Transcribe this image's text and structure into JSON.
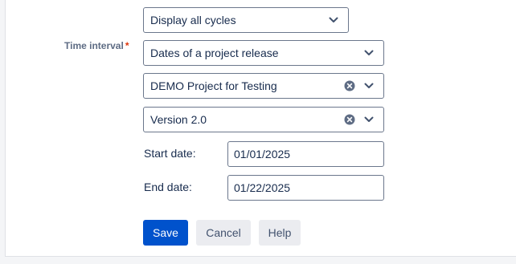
{
  "top_cutoff_text": "",
  "cycle_select": {
    "value": "Display all cycles",
    "icon": "chevron-down-icon"
  },
  "time_interval": {
    "label": "Time interval",
    "required_marker": "*",
    "mode_select": {
      "value": "Dates of a project release"
    },
    "project_select": {
      "value": "DEMO Project for Testing"
    },
    "version_select": {
      "value": "Version 2.0"
    }
  },
  "start_date": {
    "label": "Start date:",
    "value": "01/01/2025"
  },
  "end_date": {
    "label": "End date:",
    "value": "01/22/2025"
  },
  "buttons": {
    "save": "Save",
    "cancel": "Cancel",
    "help": "Help"
  },
  "colors": {
    "primary": "#0052cc",
    "required": "#de350b",
    "secondary_bg": "#ebecf0"
  }
}
